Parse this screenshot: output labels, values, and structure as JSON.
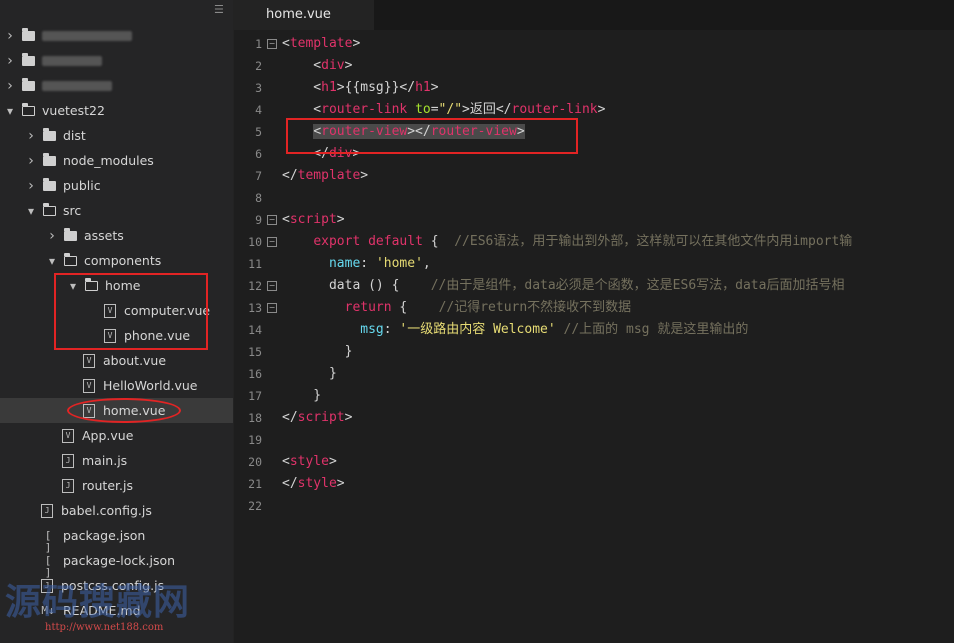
{
  "sidebar": {
    "items": [
      {
        "label": "",
        "type": "folder",
        "depth": 0,
        "expanded": false,
        "obscured": true
      },
      {
        "label": "",
        "type": "folder",
        "depth": 0,
        "expanded": false,
        "obscured": true
      },
      {
        "label": "",
        "type": "folder",
        "depth": 0,
        "expanded": false,
        "obscured": true
      },
      {
        "label": "vuetest22",
        "type": "folder",
        "depth": 0,
        "expanded": true
      },
      {
        "label": "dist",
        "type": "folder",
        "depth": 1,
        "expanded": false
      },
      {
        "label": "node_modules",
        "type": "folder",
        "depth": 1,
        "expanded": false
      },
      {
        "label": "public",
        "type": "folder",
        "depth": 1,
        "expanded": false
      },
      {
        "label": "src",
        "type": "folder",
        "depth": 1,
        "expanded": true
      },
      {
        "label": "assets",
        "type": "folder",
        "depth": 2,
        "expanded": false
      },
      {
        "label": "components",
        "type": "folder",
        "depth": 2,
        "expanded": true
      },
      {
        "label": "home",
        "type": "folder",
        "depth": 3,
        "expanded": true
      },
      {
        "label": "computer.vue",
        "type": "vue",
        "depth": 4
      },
      {
        "label": "phone.vue",
        "type": "vue",
        "depth": 4
      },
      {
        "label": "about.vue",
        "type": "vue",
        "depth": 3
      },
      {
        "label": "HelloWorld.vue",
        "type": "vue",
        "depth": 3
      },
      {
        "label": "home.vue",
        "type": "vue",
        "depth": 3,
        "selected": true
      },
      {
        "label": "App.vue",
        "type": "vue",
        "depth": 2
      },
      {
        "label": "main.js",
        "type": "js",
        "depth": 2
      },
      {
        "label": "router.js",
        "type": "js",
        "depth": 2
      },
      {
        "label": "babel.config.js",
        "type": "js",
        "depth": 1
      },
      {
        "label": "package.json",
        "type": "json",
        "depth": 1
      },
      {
        "label": "package-lock.json",
        "type": "json",
        "depth": 1
      },
      {
        "label": "postcss.config.js",
        "type": "js",
        "depth": 1
      },
      {
        "label": "README.md",
        "type": "md",
        "depth": 1
      }
    ]
  },
  "editor": {
    "tab_label": "home.vue",
    "lines": [
      {
        "n": "1",
        "fold": "⊟",
        "tokens": [
          [
            "p",
            "<"
          ],
          [
            "t",
            "template"
          ],
          [
            "p",
            ">"
          ]
        ]
      },
      {
        "n": "2",
        "tokens": [
          [
            "p",
            "    <"
          ],
          [
            "t",
            "div"
          ],
          [
            "p",
            ">"
          ]
        ]
      },
      {
        "n": "3",
        "tokens": [
          [
            "p",
            "    <"
          ],
          [
            "t",
            "h1"
          ],
          [
            "p",
            ">{{msg}}</"
          ],
          [
            "t",
            "h1"
          ],
          [
            "p",
            ">"
          ]
        ]
      },
      {
        "n": "4",
        "tokens": [
          [
            "p",
            "    <"
          ],
          [
            "t",
            "router-link"
          ],
          [
            "p",
            " "
          ],
          [
            "a",
            "to"
          ],
          [
            "p",
            "="
          ],
          [
            "s",
            "\"/\""
          ],
          [
            "p",
            ">返回</"
          ],
          [
            "t",
            "router-link"
          ],
          [
            "p",
            ">"
          ]
        ]
      },
      {
        "n": "5",
        "tokens": [
          [
            "p",
            "    "
          ],
          [
            "hl-p",
            "<"
          ],
          [
            "hl-t",
            "router-view"
          ],
          [
            "hl-p",
            "></"
          ],
          [
            "hl-t",
            "router-view"
          ],
          [
            "hl-p",
            ">"
          ]
        ]
      },
      {
        "n": "6",
        "tokens": [
          [
            "p",
            "    </"
          ],
          [
            "t",
            "div"
          ],
          [
            "p",
            ">"
          ]
        ]
      },
      {
        "n": "7",
        "tokens": [
          [
            "p",
            "</"
          ],
          [
            "t",
            "template"
          ],
          [
            "p",
            ">"
          ]
        ]
      },
      {
        "n": "8",
        "tokens": []
      },
      {
        "n": "9",
        "fold": "⊟",
        "tokens": [
          [
            "p",
            "<"
          ],
          [
            "t",
            "script"
          ],
          [
            "p",
            ">"
          ]
        ]
      },
      {
        "n": "10",
        "fold": "⊟",
        "tokens": [
          [
            "p",
            "    "
          ],
          [
            "k",
            "export"
          ],
          [
            "p",
            " "
          ],
          [
            "k",
            "default"
          ],
          [
            "p",
            " {  "
          ],
          [
            "c",
            "//ES6语法，用于输出到外部，这样就可以在其他文件内用import输"
          ]
        ]
      },
      {
        "n": "11",
        "tokens": [
          [
            "p",
            "      "
          ],
          [
            "v",
            "name"
          ],
          [
            "p",
            ": "
          ],
          [
            "s",
            "'home'"
          ],
          [
            "p",
            ","
          ]
        ]
      },
      {
        "n": "12",
        "fold": "⊟",
        "tokens": [
          [
            "p",
            "      data () {    "
          ],
          [
            "c",
            "//由于是组件，data必须是个函数，这是ES6写法，data后面加括号相"
          ]
        ]
      },
      {
        "n": "13",
        "fold": "⊟",
        "tokens": [
          [
            "p",
            "        "
          ],
          [
            "k",
            "return"
          ],
          [
            "p",
            " {    "
          ],
          [
            "c",
            "//记得return不然接收不到数据"
          ]
        ]
      },
      {
        "n": "14",
        "tokens": [
          [
            "p",
            "          "
          ],
          [
            "v",
            "msg"
          ],
          [
            "p",
            ": "
          ],
          [
            "s",
            "'一级路由内容 Welcome'"
          ],
          [
            "p",
            " "
          ],
          [
            "c",
            "//上面的 msg 就是这里输出的"
          ]
        ]
      },
      {
        "n": "15",
        "tokens": [
          [
            "p",
            "        }"
          ]
        ]
      },
      {
        "n": "16",
        "tokens": [
          [
            "p",
            "      }"
          ]
        ]
      },
      {
        "n": "17",
        "tokens": [
          [
            "p",
            "    }"
          ]
        ]
      },
      {
        "n": "18",
        "tokens": [
          [
            "p",
            "</"
          ],
          [
            "t",
            "script"
          ],
          [
            "p",
            ">"
          ]
        ]
      },
      {
        "n": "19",
        "tokens": []
      },
      {
        "n": "20",
        "tokens": [
          [
            "p",
            "<"
          ],
          [
            "t",
            "style"
          ],
          [
            "p",
            ">"
          ]
        ]
      },
      {
        "n": "21",
        "tokens": [
          [
            "p",
            "</"
          ],
          [
            "t",
            "style"
          ],
          [
            "p",
            ">"
          ]
        ]
      },
      {
        "n": "22",
        "tokens": []
      }
    ]
  },
  "watermark": {
    "text": "源码搜藏网",
    "url": "http://www.net188.com"
  },
  "colors": {
    "annotation": "#e22424",
    "tag": "#e0336a",
    "string": "#e6db74",
    "attr": "#a6e22e",
    "comment": "#75715e",
    "property": "#66d9ef"
  }
}
